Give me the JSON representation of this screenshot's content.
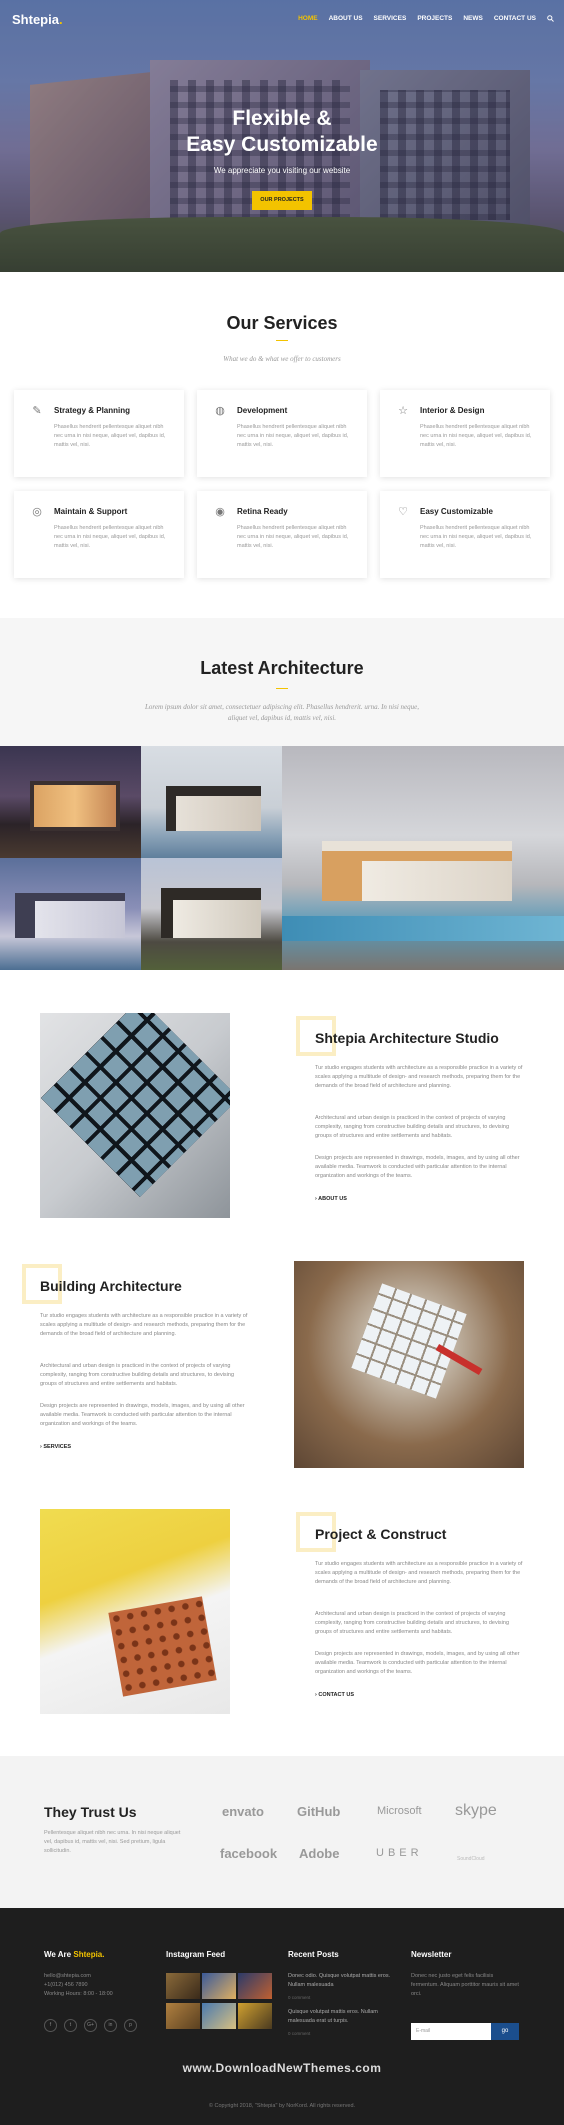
{
  "brand": {
    "name": "Shtepia",
    "dot": "."
  },
  "nav": {
    "items": [
      "HOME",
      "ABOUT US",
      "SERVICES",
      "PROJECTS",
      "NEWS",
      "CONTACT US"
    ],
    "active": "HOME",
    "search_icon": "search-icon"
  },
  "hero": {
    "title_line1": "Flexible &",
    "title_line2": "Easy Customizable",
    "subtitle": "We appreciate you visiting our website",
    "button": "OUR PROJECTS"
  },
  "services": {
    "title": "Our Services",
    "subtitle": "What we do & what we offer to customers",
    "items": [
      {
        "icon": "pencil-ruler-icon",
        "title": "Strategy & Planning",
        "desc": "Phasellus hendrerit pellentesque aliquet nibh nec urna in nisi neque, aliquet vel, dapibus id, mattis vel, nisi."
      },
      {
        "icon": "globe-icon",
        "title": "Development",
        "desc": "Phasellus hendrerit pellentesque aliquet nibh nec urna in nisi neque, aliquet vel, dapibus id, mattis vel, nisi."
      },
      {
        "icon": "star-icon",
        "title": "Interior & Design",
        "desc": "Phasellus hendrerit pellentesque aliquet nibh nec urna in nisi neque, aliquet vel, dapibus id, mattis vel, nisi."
      },
      {
        "icon": "lifebuoy-icon",
        "title": "Maintain & Support",
        "desc": "Phasellus hendrerit pellentesque aliquet nibh nec urna in nisi neque, aliquet vel, dapibus id, mattis vel, nisi."
      },
      {
        "icon": "eye-icon",
        "title": "Retina Ready",
        "desc": "Phasellus hendrerit pellentesque aliquet nibh nec urna in nisi neque, aliquet vel, dapibus id, mattis vel, nisi."
      },
      {
        "icon": "heart-icon",
        "title": "Easy Customizable",
        "desc": "Phasellus hendrerit pellentesque aliquet nibh nec urna in nisi neque, aliquet vel, dapibus id, mattis vel, nisi."
      }
    ]
  },
  "latest": {
    "title": "Latest Architecture",
    "subtitle": "Lorem ipsum dolor sit amet, consectetuer adipiscing elit. Phasellus hendrerit. urna. In nisi neque, aliquet vel, dapibus id, mattis vel, nisi."
  },
  "features": [
    {
      "title": "Shtepia Architecture Studio",
      "p1": "Tur studio engages students with architecture as a responsible practice in a variety of scales applying a multitude of design- and research methods, preparing them for the demands of the broad field of architecture and planning.",
      "p2": "Architectural and urban design is practiced in the context of projects of varying complexity, ranging from constructive building details and structures, to devising groups of structures and entire settlements and habitats.",
      "p3": "Design projects are represented in drawings, models, images, and by using all other available media. Teamwork is conducted with particular attention to the internal organization and workings of the teams.",
      "link": "ABOUT US"
    },
    {
      "title": "Building Architecture",
      "p1": "Tur studio engages students with architecture as a responsible practice in a variety of scales applying a multitude of design- and research methods, preparing them for the demands of the broad field of architecture and planning.",
      "p2": "Architectural and urban design is practiced in the context of projects of varying complexity, ranging from constructive building details and structures, to devising groups of structures and entire settlements and habitats.",
      "p3": "Design projects are represented in drawings, models, images, and by using all other available media. Teamwork is conducted with particular attention to the internal organization and workings of the teams.",
      "link": "SERVICES"
    },
    {
      "title": "Project & Construct",
      "p1": "Tur studio engages students with architecture as a responsible practice in a variety of scales applying a multitude of design- and research methods, preparing them for the demands of the broad field of architecture and planning.",
      "p2": "Architectural and urban design is practiced in the context of projects of varying complexity, ranging from constructive building details and structures, to devising groups of structures and entire settlements and habitats.",
      "p3": "Design projects are represented in drawings, models, images, and by using all other available media. Teamwork is conducted with particular attention to the internal organization and workings of the teams.",
      "link": "CONTACT US"
    }
  ],
  "trust": {
    "title": "They Trust Us",
    "desc": "Pellentesque aliquet nibh nec urna. In nisi neque aliquet vel, dapibus id, mattis vel, nisi. Sed pretium, ligula sollicitudin.",
    "brands": [
      "envato",
      "GitHub",
      "Microsoft",
      "skype",
      "facebook",
      "Adobe",
      "UBER",
      "SoundCloud"
    ]
  },
  "footer": {
    "about_title": "We Are",
    "about_brand": "Shtepia.",
    "email": "hello@shtepia.com",
    "phone": "+1(012) 456 7890",
    "hours": "Working Hours: 8:00 - 18:00",
    "socials": [
      "f",
      "t",
      "G+",
      "in",
      "p"
    ],
    "instagram_title": "Instagram Feed",
    "posts_title": "Recent Posts",
    "posts": [
      {
        "text": "Donec odio. Quisque volutpat mattis eros. Nullam malesuada",
        "meta": "0 comment"
      },
      {
        "text": "Quisque volutpat mattis eros. Nullam malesuada erat ut turpis.",
        "meta": "0 comment"
      }
    ],
    "newsletter_title": "Newsletter",
    "newsletter_text": "Donec nec justo eget felis facilisis fermentum. Aliquam porttitor mauris sit amet orci.",
    "newsletter_placeholder": "E-mail",
    "newsletter_button": "go",
    "watermark": "www.DownloadNewThemes.com",
    "copyright": "© Copyright 2018, \"Shtepia\" by NorKord. All rights reserved."
  },
  "colors": {
    "accent": "#f3c300",
    "dark": "#1e1e1e",
    "newsletter_button": "#1b4e8d"
  }
}
